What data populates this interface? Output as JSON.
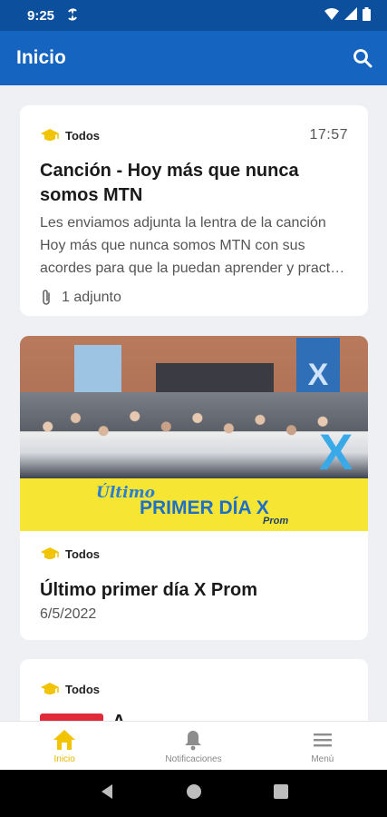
{
  "status_bar": {
    "time": "9:25",
    "sync_icon": "sync-icon"
  },
  "app_bar": {
    "title": "Inicio",
    "search_icon": "search-icon"
  },
  "feed": [
    {
      "tag": "Todos",
      "time": "17:57",
      "title": "Canción - Hoy más que nunca somos MTN",
      "body": "Les enviamos adjunta la lentra de la canción Hoy más que nunca somos MTN con sus acordes para que la puedan aprender y pract…",
      "attachment_label": "1 adjunto"
    },
    {
      "tag": "Todos",
      "title": "Último primer día X Prom",
      "date": "6/5/2022",
      "image_text": {
        "ultimo": "Último",
        "primer": "PRIMER DÍA X",
        "prom": "Prom",
        "x_mark": "X"
      }
    },
    {
      "tag": "Todos",
      "title_partial": "A"
    }
  ],
  "bottom_nav": [
    {
      "label": "Inicio",
      "icon": "home-icon",
      "active": true
    },
    {
      "label": "Notificaciones",
      "icon": "bell-icon",
      "active": false
    },
    {
      "label": "Menú",
      "icon": "menu-icon",
      "active": false
    }
  ],
  "colors": {
    "primary": "#1565c0",
    "status": "#0c4f9c",
    "accent": "#e5b700",
    "background": "#eef0f4"
  }
}
